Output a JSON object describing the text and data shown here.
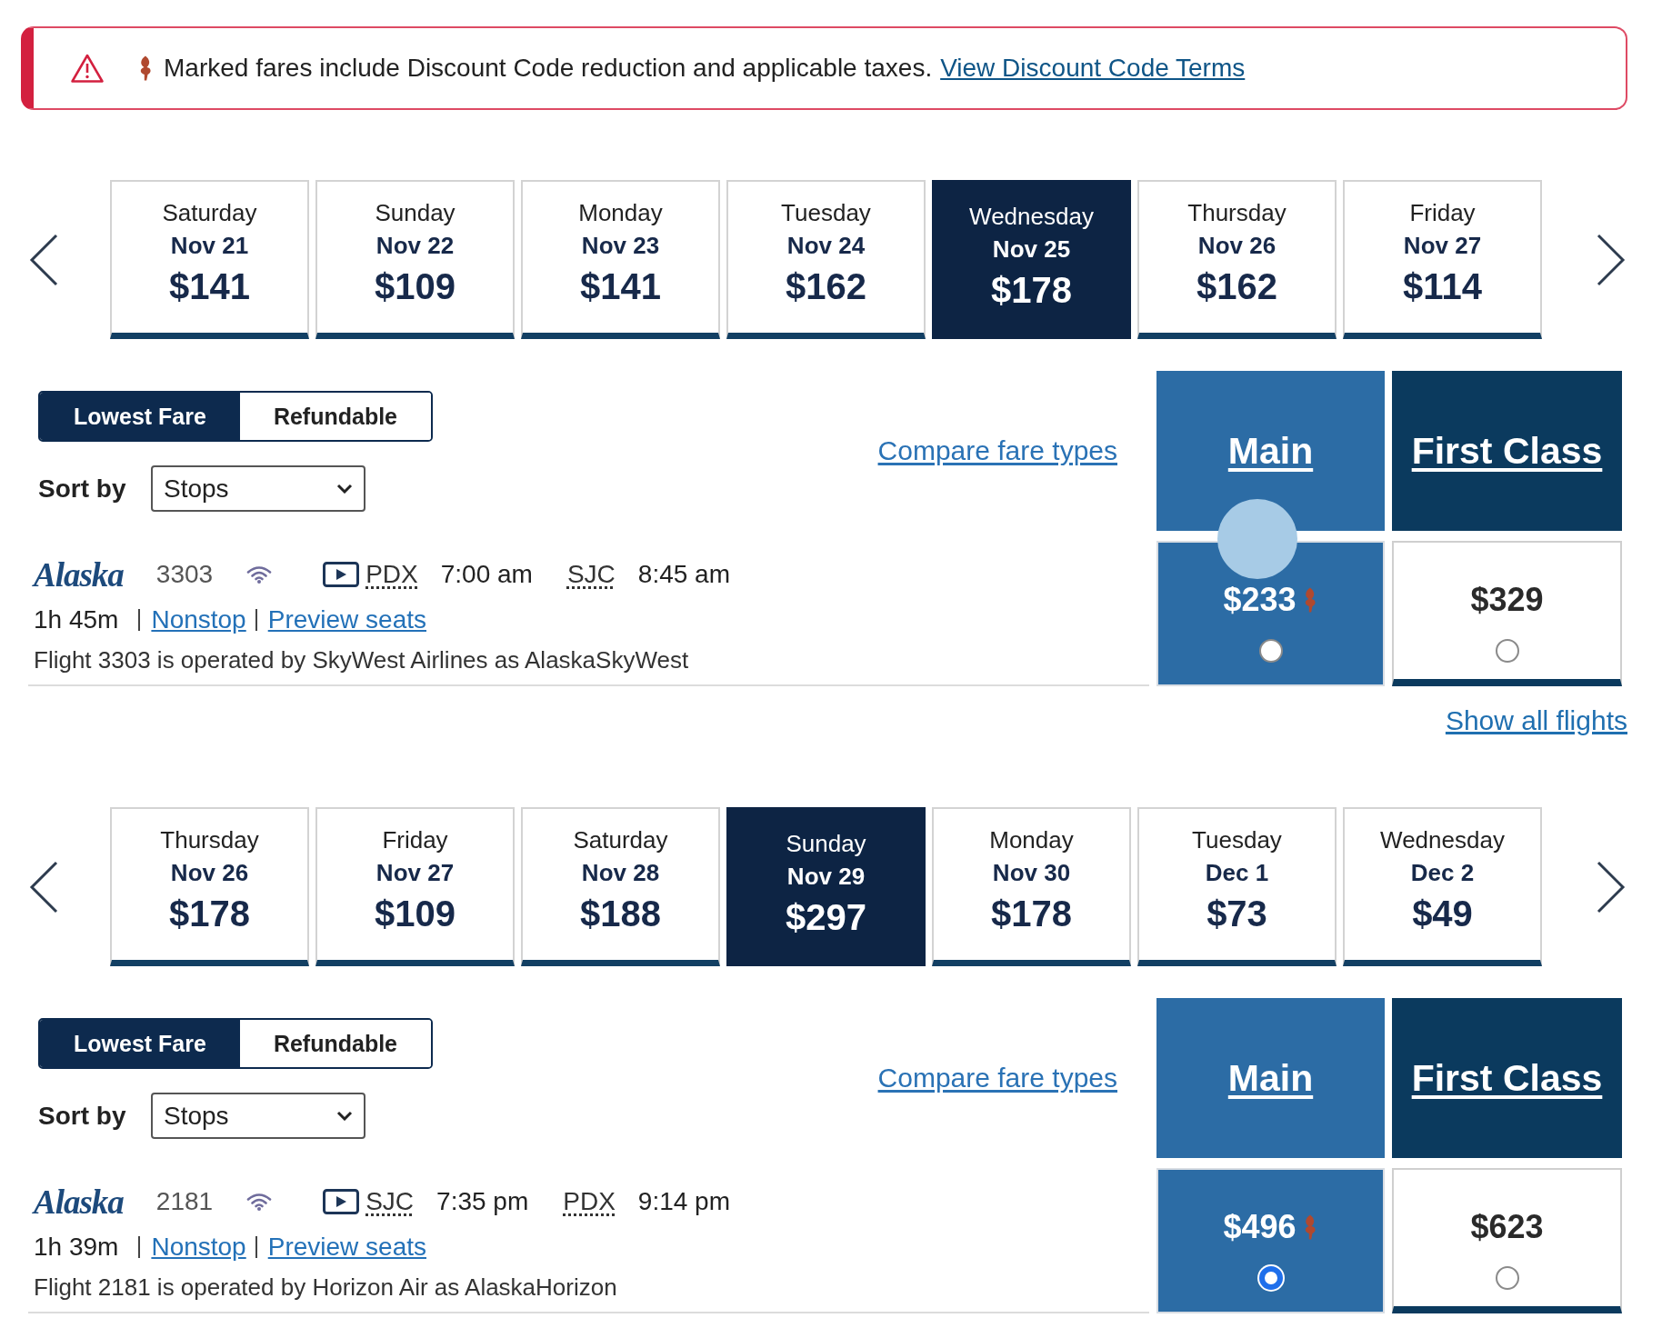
{
  "alert": {
    "message": "Marked fares include Discount Code reduction and applicable taxes.",
    "link": "View Discount Code Terms"
  },
  "segments": [
    {
      "dates": [
        {
          "day": "Saturday",
          "date": "Nov 21",
          "price": "$141",
          "selected": false
        },
        {
          "day": "Sunday",
          "date": "Nov 22",
          "price": "$109",
          "selected": false
        },
        {
          "day": "Monday",
          "date": "Nov 23",
          "price": "$141",
          "selected": false
        },
        {
          "day": "Tuesday",
          "date": "Nov 24",
          "price": "$162",
          "selected": false
        },
        {
          "day": "Wednesday",
          "date": "Nov 25",
          "price": "$178",
          "selected": true
        },
        {
          "day": "Thursday",
          "date": "Nov 26",
          "price": "$162",
          "selected": false
        },
        {
          "day": "Friday",
          "date": "Nov 27",
          "price": "$114",
          "selected": false
        }
      ],
      "fare_filter": [
        {
          "label": "Lowest Fare",
          "selected": true
        },
        {
          "label": "Refundable",
          "selected": false
        }
      ],
      "sort": {
        "label": "Sort by",
        "value": "Stops"
      },
      "compare_link": "Compare fare types",
      "cabins": [
        {
          "label": "Main",
          "kind": "main"
        },
        {
          "label": "First Class",
          "kind": "first"
        }
      ],
      "flight": {
        "airline": "Alaska",
        "number": "3303",
        "departure_airport": "PDX",
        "departure_time": "7:00 am",
        "arrival_airport": "SJC",
        "arrival_time": "8:45 am",
        "duration": "1h 45m",
        "stops": "Nonstop",
        "seats_link": "Preview seats",
        "operated_by": "Flight 3303 is operated by SkyWest Airlines as AlaskaSkyWest",
        "fares": [
          {
            "price": "$233",
            "discounted": true,
            "selected": false,
            "click_highlight": true
          },
          {
            "price": "$329",
            "discounted": false,
            "selected": false,
            "click_highlight": false
          }
        ]
      },
      "show_all": "Show all flights"
    },
    {
      "dates": [
        {
          "day": "Thursday",
          "date": "Nov 26",
          "price": "$178",
          "selected": false
        },
        {
          "day": "Friday",
          "date": "Nov 27",
          "price": "$109",
          "selected": false
        },
        {
          "day": "Saturday",
          "date": "Nov 28",
          "price": "$188",
          "selected": false
        },
        {
          "day": "Sunday",
          "date": "Nov 29",
          "price": "$297",
          "selected": true
        },
        {
          "day": "Monday",
          "date": "Nov 30",
          "price": "$178",
          "selected": false
        },
        {
          "day": "Tuesday",
          "date": "Dec 1",
          "price": "$73",
          "selected": false
        },
        {
          "day": "Wednesday",
          "date": "Dec 2",
          "price": "$49",
          "selected": false
        }
      ],
      "fare_filter": [
        {
          "label": "Lowest Fare",
          "selected": true
        },
        {
          "label": "Refundable",
          "selected": false
        }
      ],
      "sort": {
        "label": "Sort by",
        "value": "Stops"
      },
      "compare_link": "Compare fare types",
      "cabins": [
        {
          "label": "Main",
          "kind": "main"
        },
        {
          "label": "First Class",
          "kind": "first"
        }
      ],
      "flight": {
        "airline": "Alaska",
        "number": "2181",
        "departure_airport": "SJC",
        "departure_time": "7:35 pm",
        "arrival_airport": "PDX",
        "arrival_time": "9:14 pm",
        "duration": "1h 39m",
        "stops": "Nonstop",
        "seats_link": "Preview seats",
        "operated_by": "Flight 2181 is operated by Horizon Air as AlaskaHorizon",
        "fares": [
          {
            "price": "$496",
            "discounted": true,
            "selected": true,
            "click_highlight": false
          },
          {
            "price": "$623",
            "discounted": false,
            "selected": false,
            "click_highlight": false
          }
        ]
      }
    }
  ]
}
